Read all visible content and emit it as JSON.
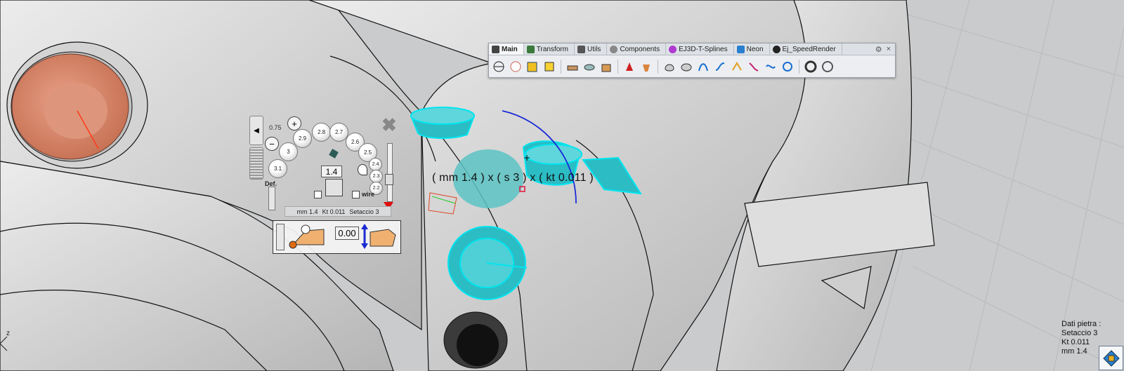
{
  "toolbar": {
    "tabs": [
      {
        "label": "Main",
        "icon": "ej-main-icon",
        "color": "#444"
      },
      {
        "label": "Transform",
        "icon": "transform-icon",
        "color": "#3a7a3a"
      },
      {
        "label": "Utils",
        "icon": "utils-icon",
        "color": "#555"
      },
      {
        "label": "Components",
        "icon": "components-icon",
        "color": "#666"
      },
      {
        "label": "EJ3D-T-Splines",
        "icon": "tsplines-icon",
        "color": "#b03ad0"
      },
      {
        "label": "Neon",
        "icon": "neon-icon",
        "color": "#2a7fd0"
      },
      {
        "label": "Ej_SpeedRender",
        "icon": "speedrender-icon",
        "color": "#222"
      }
    ],
    "gear_icon": "gear-icon",
    "close_label": "×"
  },
  "gem_panel": {
    "min_label": "0.75",
    "sizes": [
      "3.1",
      "3",
      "2.9",
      "2.8",
      "2.7",
      "2.6",
      "2.5",
      "2.4",
      "2.3",
      "2.2"
    ],
    "size_value": "1.4",
    "def_label": "Def.",
    "wire_label": "wire",
    "info": {
      "mm": "mm 1.4",
      "kt": "Kt 0.011",
      "setaccio": "Setaccio 3"
    },
    "offset_value": "0.00"
  },
  "dimension_label": "( mm 1.4 ) x ( s 3 ) x ( kt 0.011 )",
  "stone_info": {
    "title": "Dati pietra :",
    "setaccio": "Setaccio 3",
    "kt": "Kt 0.011",
    "mm": "mm 1.4"
  },
  "axis_label": "z",
  "colors": {
    "cyan": "#27c7cf",
    "copper": "#d98466",
    "viewport": "#c9cbcd",
    "model": "#d9d9d9"
  }
}
